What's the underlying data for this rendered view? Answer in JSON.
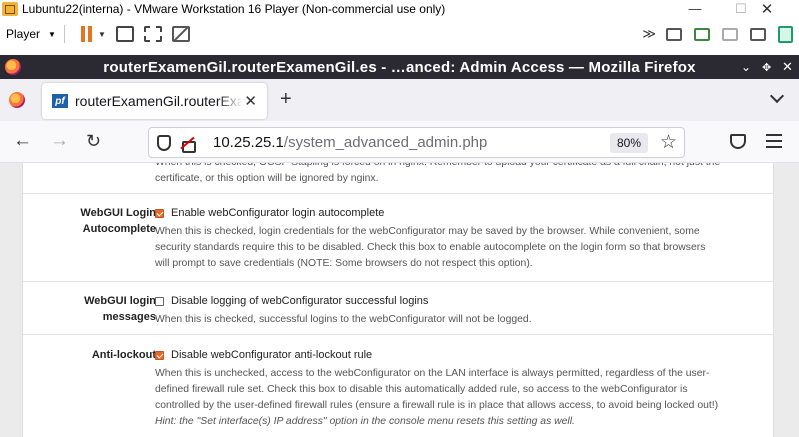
{
  "vmware": {
    "title": "Lubuntu22(interna) - VMware Workstation 16 Player (Non-commercial use only)",
    "player_label": "Player",
    "minimize_glyph": "—",
    "maximize_glyph": "☐",
    "close_glyph": "✕",
    "more_glyph": "≫"
  },
  "firefox": {
    "window_title": "routerExamenGil.routerExamenGil.es - …anced: Admin Access — Mozilla Firefox",
    "minimize_glyph": "⌄",
    "maximize_glyph": "✥",
    "close_glyph": "✕",
    "tab": {
      "favicon_text": "pf",
      "label": "routerExamenGil.routerExamenGil.es - System: Advanced: Admin Access",
      "close_glyph": "✕"
    },
    "newtab_glyph": "+",
    "nav": {
      "back_glyph": "←",
      "forward_glyph": "→",
      "reload_glyph": "↻",
      "url_host": "10.25.25.1",
      "url_path": "/system_advanced_admin.php",
      "zoom": "80%",
      "star_glyph": "☆"
    }
  },
  "page": {
    "top_cut_line1": "When this is checked, OCSP Stapling is forced on in nginx. Remember to upload your certificate as a full chain, not just the",
    "top_cut_line2": "certificate, or this option will be ignored by nginx.",
    "rows": [
      {
        "label_line1": "WebGUI Login",
        "label_line2": "Autocomplete",
        "checked": true,
        "checkbox_label": "Enable webConfigurator login autocomplete",
        "help": [
          "When this is checked, login credentials for the webConfigurator may be saved by the browser. While convenient, some",
          "security standards require this to be disabled. Check this box to enable autocomplete on the login form so that browsers",
          "will prompt to save credentials (NOTE: Some browsers do not respect this option)."
        ]
      },
      {
        "label_line1": "WebGUI login",
        "label_line2": "messages",
        "checked": false,
        "checkbox_label": "Disable logging of webConfigurator successful logins",
        "help": [
          "When this is checked, successful logins to the webConfigurator will not be logged."
        ]
      },
      {
        "label_line1": "Anti-lockout",
        "label_line2": "",
        "checked": true,
        "checkbox_label": "Disable webConfigurator anti-lockout rule",
        "help": [
          "When this is unchecked, access to the webConfigurator on the LAN interface is always permitted, regardless of the user-",
          "defined firewall rule set. Check this box to disable this automatically added rule, so access to the webConfigurator is",
          "controlled by the user-defined firewall rules (ensure a firewall rule is in place that allows access, to avoid being locked out!)"
        ],
        "hint": "Hint: the \"Set interface(s) IP address\" option in the console menu resets this setting as well."
      }
    ]
  },
  "colors": {
    "firefox_titlebar": "#2b2a33",
    "checkbox_checked": "#e86a2a",
    "pause_orange": "#e8731e"
  }
}
